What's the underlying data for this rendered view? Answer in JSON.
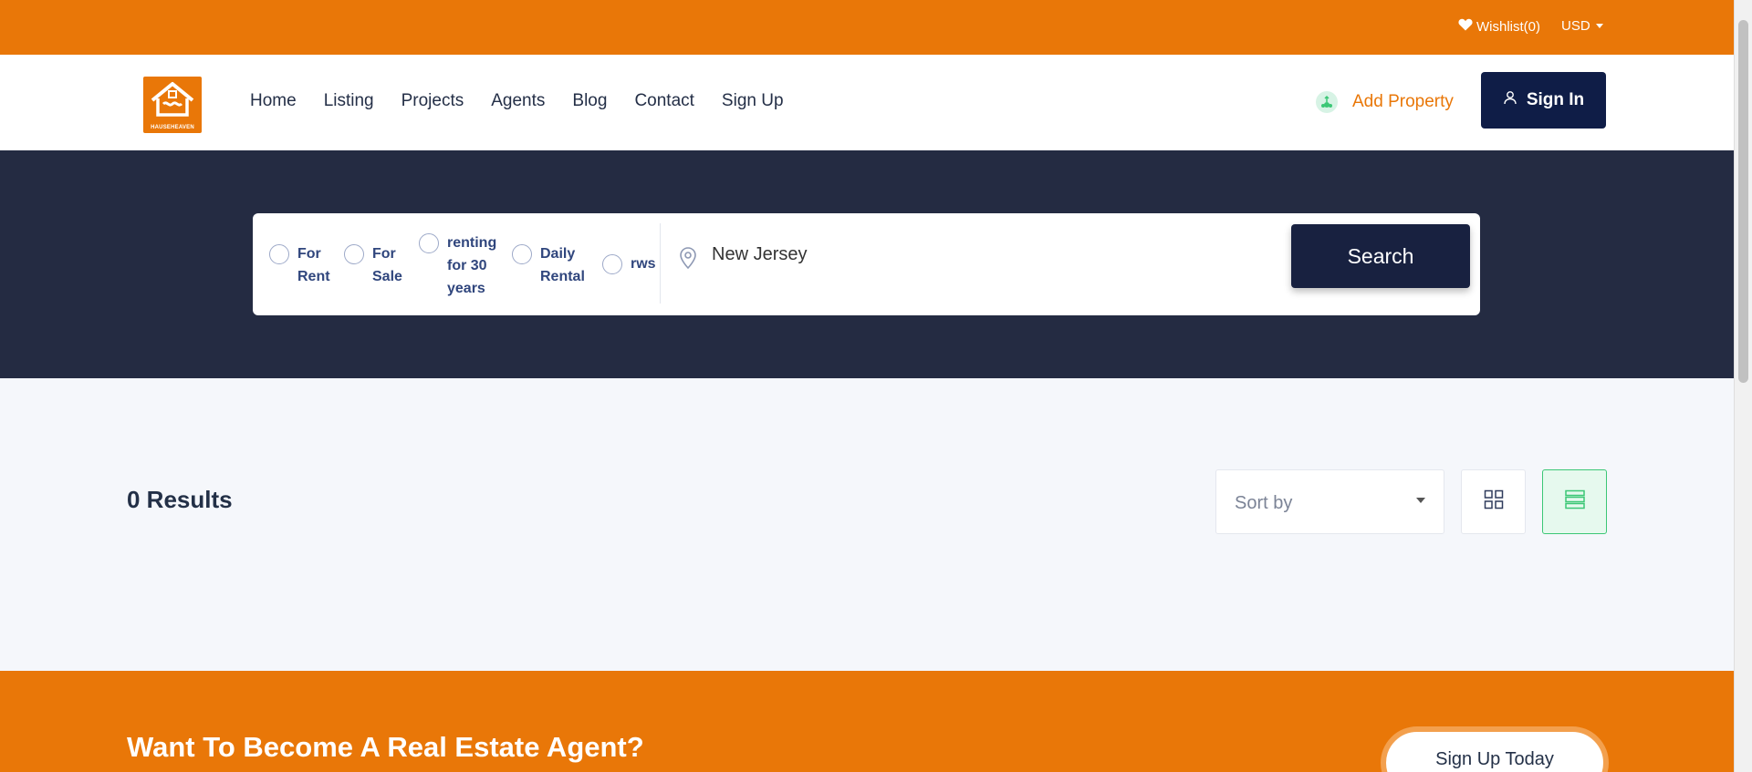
{
  "topbar": {
    "wishlist": "Wishlist(0)",
    "currency": "USD"
  },
  "header": {
    "logo_text": "HAUSEHEAVEN",
    "nav": [
      "Home",
      "Listing",
      "Projects",
      "Agents",
      "Blog",
      "Contact",
      "Sign Up"
    ],
    "add_property": "Add Property",
    "sign_in": "Sign In"
  },
  "search": {
    "options": [
      {
        "label": "For Rent"
      },
      {
        "label": "For Sale"
      },
      {
        "label": "renting for 30 years"
      },
      {
        "label": "Daily Rental"
      },
      {
        "label": "rws"
      }
    ],
    "location": "New Jersey",
    "button": "Search"
  },
  "results": {
    "count_text": "0 Results",
    "sort_placeholder": "Sort by"
  },
  "footer": {
    "title": "Want To Become A Real Estate Agent?",
    "cta": "Sign Up Today"
  },
  "colors": {
    "brand_orange": "#e97708",
    "navy": "#0f1d47",
    "hero_bg": "#242b42",
    "accent_green": "#3cc776"
  }
}
